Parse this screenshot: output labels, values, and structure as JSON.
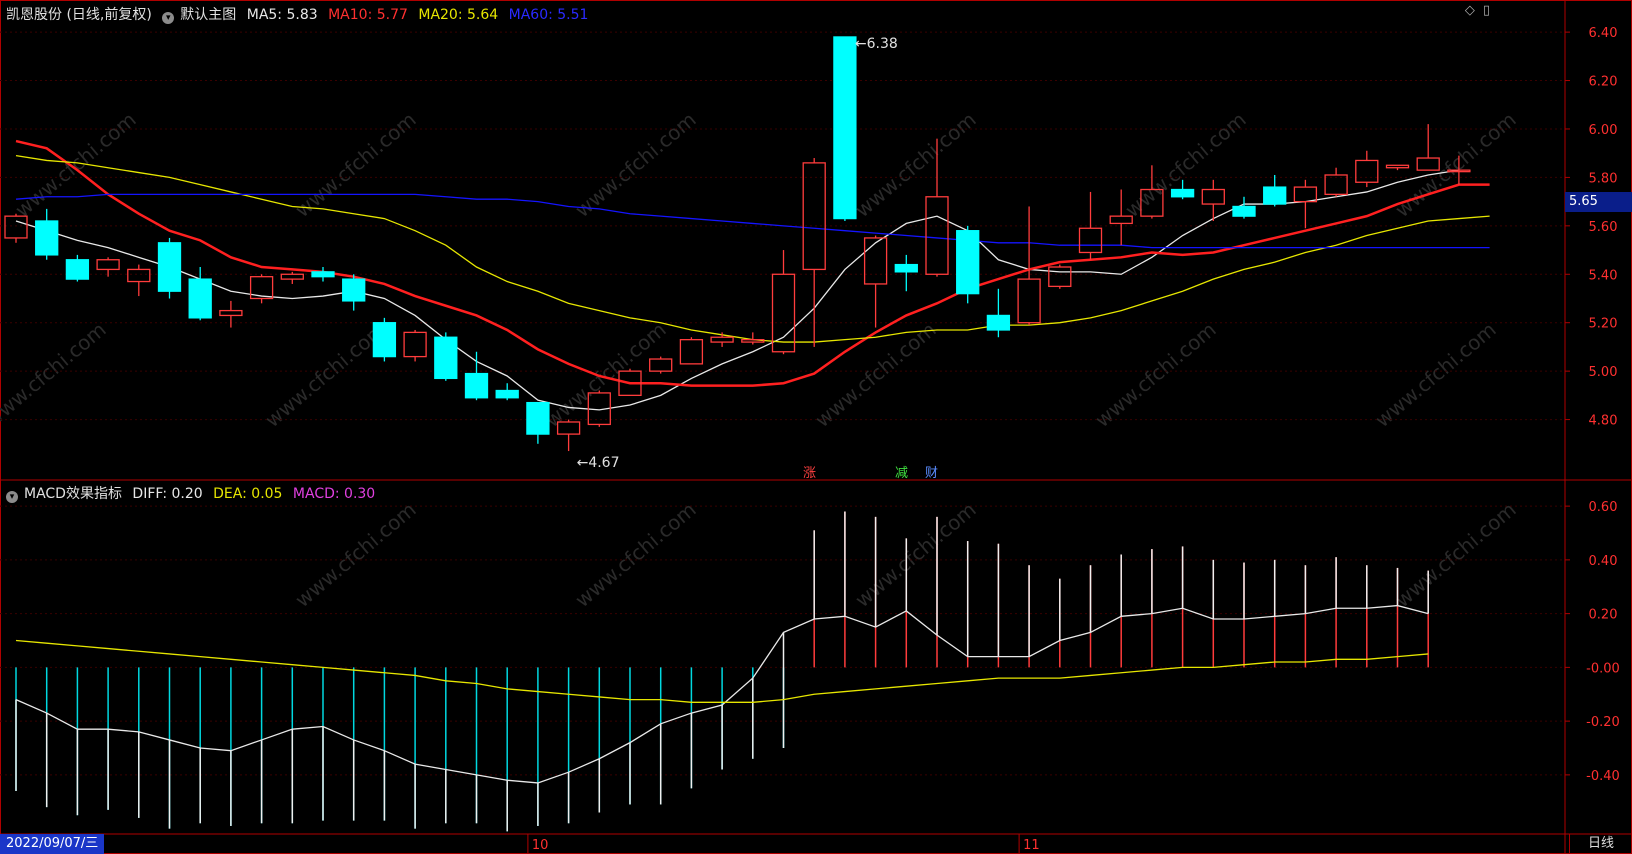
{
  "header": {
    "stock_title": "凯恩股份 (日线,前复权)",
    "main_view": "默认主图",
    "ma5": "MA5: 5.83",
    "ma10": "MA10: 5.77",
    "ma20": "MA20: 5.64",
    "ma60": "MA60: 5.51"
  },
  "macd_header": {
    "title": "MACD效果指标",
    "diff": "DIFF: 0.20",
    "dea": "DEA: 0.05",
    "macd": "MACD: 0.30"
  },
  "footer": {
    "date": "2022/09/07/三",
    "period": "日线"
  },
  "current_price_label": "5.65",
  "event_tags": [
    "涨",
    "减",
    "财"
  ],
  "icons": [
    "diamond-icon",
    "window-icon"
  ],
  "colors": {
    "up": "#ff3c3c",
    "down": "#00ffff",
    "ma5": "#e8e8e8",
    "ma10": "#ff2020",
    "ma20": "#e6e600",
    "ma60": "#1414ff",
    "axis": "#b00000",
    "diff": "#e8e8e8",
    "dea": "#e6e600",
    "macd_pos": "#ff3c3c",
    "macd_neg": "#00d8e0"
  },
  "chart_data": [
    {
      "type": "candlestick",
      "title": "凯恩股份 (日线,前复权)",
      "ylim": [
        4.6,
        6.45
      ],
      "yticks": [
        4.8,
        5.0,
        5.2,
        5.4,
        5.6,
        5.8,
        6.0,
        6.2,
        6.4
      ],
      "ytick_labels": [
        "4.80",
        "5.00",
        "5.20",
        "5.40",
        "5.60",
        "5.80",
        "6.00",
        "6.20",
        "6.40"
      ],
      "x_labels": [
        {
          "index": 17,
          "label": "10"
        },
        {
          "index": 33,
          "label": "11"
        }
      ],
      "annotations": [
        {
          "index": 27,
          "value": 6.38,
          "label": "6.38"
        },
        {
          "index": 18,
          "value": 4.67,
          "label": "4.67"
        }
      ],
      "candles": [
        {
          "o": 5.55,
          "h": 5.65,
          "l": 5.53,
          "c": 5.64
        },
        {
          "o": 5.62,
          "h": 5.67,
          "l": 5.46,
          "c": 5.48
        },
        {
          "o": 5.46,
          "h": 5.48,
          "l": 5.37,
          "c": 5.38
        },
        {
          "o": 5.42,
          "h": 5.47,
          "l": 5.39,
          "c": 5.46
        },
        {
          "o": 5.37,
          "h": 5.44,
          "l": 5.31,
          "c": 5.42
        },
        {
          "o": 5.53,
          "h": 5.55,
          "l": 5.3,
          "c": 5.33
        },
        {
          "o": 5.38,
          "h": 5.43,
          "l": 5.21,
          "c": 5.22
        },
        {
          "o": 5.23,
          "h": 5.29,
          "l": 5.18,
          "c": 5.25
        },
        {
          "o": 5.3,
          "h": 5.4,
          "l": 5.28,
          "c": 5.39
        },
        {
          "o": 5.38,
          "h": 5.41,
          "l": 5.36,
          "c": 5.4
        },
        {
          "o": 5.41,
          "h": 5.43,
          "l": 5.37,
          "c": 5.39
        },
        {
          "o": 5.38,
          "h": 5.4,
          "l": 5.25,
          "c": 5.29
        },
        {
          "o": 5.2,
          "h": 5.22,
          "l": 5.04,
          "c": 5.06
        },
        {
          "o": 5.06,
          "h": 5.17,
          "l": 5.04,
          "c": 5.16
        },
        {
          "o": 5.14,
          "h": 5.16,
          "l": 4.96,
          "c": 4.97
        },
        {
          "o": 4.99,
          "h": 5.08,
          "l": 4.88,
          "c": 4.89
        },
        {
          "o": 4.92,
          "h": 4.95,
          "l": 4.88,
          "c": 4.89
        },
        {
          "o": 4.87,
          "h": 4.87,
          "l": 4.7,
          "c": 4.74
        },
        {
          "o": 4.74,
          "h": 4.8,
          "l": 4.67,
          "c": 4.79
        },
        {
          "o": 4.78,
          "h": 4.92,
          "l": 4.77,
          "c": 4.91
        },
        {
          "o": 4.9,
          "h": 5.01,
          "l": 4.9,
          "c": 5.0
        },
        {
          "o": 5.0,
          "h": 5.06,
          "l": 4.99,
          "c": 5.05
        },
        {
          "o": 5.03,
          "h": 5.14,
          "l": 5.03,
          "c": 5.13
        },
        {
          "o": 5.12,
          "h": 5.16,
          "l": 5.1,
          "c": 5.14
        },
        {
          "o": 5.12,
          "h": 5.16,
          "l": 5.11,
          "c": 5.13
        },
        {
          "o": 5.08,
          "h": 5.5,
          "l": 5.07,
          "c": 5.4
        },
        {
          "o": 5.42,
          "h": 5.88,
          "l": 5.1,
          "c": 5.86
        },
        {
          "o": 6.38,
          "h": 6.38,
          "l": 5.62,
          "c": 5.63
        },
        {
          "o": 5.36,
          "h": 5.56,
          "l": 5.18,
          "c": 5.55
        },
        {
          "o": 5.44,
          "h": 5.48,
          "l": 5.33,
          "c": 5.41
        },
        {
          "o": 5.4,
          "h": 5.96,
          "l": 5.39,
          "c": 5.72
        },
        {
          "o": 5.58,
          "h": 5.6,
          "l": 5.28,
          "c": 5.32
        },
        {
          "o": 5.23,
          "h": 5.34,
          "l": 5.14,
          "c": 5.17
        },
        {
          "o": 5.2,
          "h": 5.68,
          "l": 5.19,
          "c": 5.38
        },
        {
          "o": 5.35,
          "h": 5.44,
          "l": 5.34,
          "c": 5.43
        },
        {
          "o": 5.49,
          "h": 5.74,
          "l": 5.46,
          "c": 5.59
        },
        {
          "o": 5.61,
          "h": 5.75,
          "l": 5.52,
          "c": 5.64
        },
        {
          "o": 5.64,
          "h": 5.85,
          "l": 5.63,
          "c": 5.75
        },
        {
          "o": 5.75,
          "h": 5.79,
          "l": 5.71,
          "c": 5.72
        },
        {
          "o": 5.69,
          "h": 5.79,
          "l": 5.62,
          "c": 5.75
        },
        {
          "o": 5.68,
          "h": 5.72,
          "l": 5.63,
          "c": 5.64
        },
        {
          "o": 5.76,
          "h": 5.81,
          "l": 5.68,
          "c": 5.69
        },
        {
          "o": 5.7,
          "h": 5.79,
          "l": 5.59,
          "c": 5.76
        },
        {
          "o": 5.73,
          "h": 5.84,
          "l": 5.72,
          "c": 5.81
        },
        {
          "o": 5.78,
          "h": 5.91,
          "l": 5.76,
          "c": 5.87
        },
        {
          "o": 5.84,
          "h": 5.85,
          "l": 5.83,
          "c": 5.85
        },
        {
          "o": 5.83,
          "h": 6.02,
          "l": 5.83,
          "c": 5.88
        },
        {
          "o": 5.83,
          "h": 5.89,
          "l": 5.77,
          "c": 5.83
        }
      ],
      "series": [
        {
          "name": "MA5",
          "values": [
            5.62,
            5.58,
            5.54,
            5.51,
            5.47,
            5.43,
            5.38,
            5.33,
            5.31,
            5.3,
            5.31,
            5.33,
            5.3,
            5.23,
            5.13,
            5.04,
            4.98,
            4.88,
            4.85,
            4.84,
            4.86,
            4.9,
            4.97,
            5.03,
            5.08,
            5.14,
            5.26,
            5.42,
            5.53,
            5.61,
            5.64,
            5.58,
            5.46,
            5.42,
            5.41,
            5.41,
            5.4,
            5.47,
            5.56,
            5.63,
            5.69,
            5.69,
            5.7,
            5.72,
            5.74,
            5.78,
            5.81,
            5.83
          ]
        },
        {
          "name": "MA10",
          "values": [
            5.95,
            5.92,
            5.83,
            5.73,
            5.65,
            5.58,
            5.54,
            5.47,
            5.43,
            5.42,
            5.41,
            5.39,
            5.36,
            5.31,
            5.27,
            5.23,
            5.17,
            5.09,
            5.03,
            4.98,
            4.95,
            4.95,
            4.94,
            4.94,
            4.94,
            4.95,
            4.99,
            5.08,
            5.16,
            5.23,
            5.28,
            5.34,
            5.38,
            5.42,
            5.45,
            5.46,
            5.47,
            5.49,
            5.48,
            5.49,
            5.52,
            5.55,
            5.58,
            5.61,
            5.64,
            5.69,
            5.73,
            5.77,
            5.77
          ]
        },
        {
          "name": "MA20",
          "values": [
            5.89,
            5.87,
            5.86,
            5.84,
            5.82,
            5.8,
            5.77,
            5.74,
            5.71,
            5.68,
            5.67,
            5.65,
            5.63,
            5.58,
            5.52,
            5.43,
            5.37,
            5.33,
            5.28,
            5.25,
            5.22,
            5.2,
            5.17,
            5.15,
            5.13,
            5.12,
            5.12,
            5.13,
            5.14,
            5.16,
            5.17,
            5.17,
            5.19,
            5.19,
            5.2,
            5.22,
            5.25,
            5.29,
            5.33,
            5.38,
            5.42,
            5.45,
            5.49,
            5.52,
            5.56,
            5.59,
            5.62,
            5.63,
            5.64
          ]
        },
        {
          "name": "MA60",
          "values": [
            5.71,
            5.72,
            5.72,
            5.73,
            5.73,
            5.73,
            5.73,
            5.73,
            5.73,
            5.73,
            5.73,
            5.73,
            5.73,
            5.73,
            5.72,
            5.71,
            5.71,
            5.7,
            5.68,
            5.67,
            5.65,
            5.64,
            5.63,
            5.62,
            5.61,
            5.6,
            5.59,
            5.58,
            5.57,
            5.56,
            5.55,
            5.54,
            5.53,
            5.53,
            5.52,
            5.52,
            5.52,
            5.51,
            5.51,
            5.51,
            5.51,
            5.51,
            5.51,
            5.51,
            5.51,
            5.51,
            5.51,
            5.51,
            5.51
          ]
        }
      ]
    },
    {
      "type": "macd",
      "title": "MACD效果指标",
      "ylim": [
        -0.62,
        0.66
      ],
      "yticks": [
        -0.4,
        -0.2,
        0.0,
        0.2,
        0.4,
        0.6
      ],
      "ytick_labels": [
        "-0.40",
        "-0.20",
        "-0.00",
        "0.20",
        "0.40",
        "0.60"
      ],
      "series": [
        {
          "name": "DIFF",
          "values": [
            -0.12,
            -0.17,
            -0.23,
            -0.23,
            -0.24,
            -0.27,
            -0.3,
            -0.31,
            -0.27,
            -0.23,
            -0.22,
            -0.27,
            -0.31,
            -0.36,
            -0.38,
            -0.4,
            -0.42,
            -0.43,
            -0.39,
            -0.34,
            -0.28,
            -0.21,
            -0.17,
            -0.14,
            -0.04,
            0.13,
            0.18,
            0.19,
            0.15,
            0.21,
            0.12,
            0.04,
            0.04,
            0.04,
            0.1,
            0.13,
            0.19,
            0.2,
            0.22,
            0.18,
            0.18,
            0.19,
            0.2,
            0.22,
            0.22,
            0.23,
            0.2
          ]
        },
        {
          "name": "DEA",
          "values": [
            0.1,
            0.09,
            0.08,
            0.07,
            0.06,
            0.05,
            0.04,
            0.03,
            0.02,
            0.01,
            0.0,
            -0.01,
            -0.02,
            -0.03,
            -0.05,
            -0.06,
            -0.08,
            -0.09,
            -0.1,
            -0.11,
            -0.12,
            -0.12,
            -0.13,
            -0.13,
            -0.13,
            -0.12,
            -0.1,
            -0.09,
            -0.08,
            -0.07,
            -0.06,
            -0.05,
            -0.04,
            -0.04,
            -0.04,
            -0.03,
            -0.02,
            -0.01,
            0.0,
            0.0,
            0.01,
            0.02,
            0.02,
            0.03,
            0.03,
            0.04,
            0.05
          ]
        },
        {
          "name": "MACD",
          "values": [
            -0.46,
            -0.52,
            -0.55,
            -0.53,
            -0.56,
            -0.6,
            -0.58,
            -0.59,
            -0.58,
            -0.58,
            -0.57,
            -0.57,
            -0.57,
            -0.6,
            -0.58,
            -0.58,
            -0.61,
            -0.59,
            -0.58,
            -0.54,
            -0.51,
            -0.51,
            -0.45,
            -0.38,
            -0.34,
            -0.3,
            0.51,
            0.58,
            0.56,
            0.48,
            0.56,
            0.47,
            0.46,
            0.38,
            0.33,
            0.38,
            0.42,
            0.44,
            0.45,
            0.4,
            0.39,
            0.4,
            0.38,
            0.41,
            0.38,
            0.37,
            0.36
          ]
        }
      ]
    }
  ]
}
